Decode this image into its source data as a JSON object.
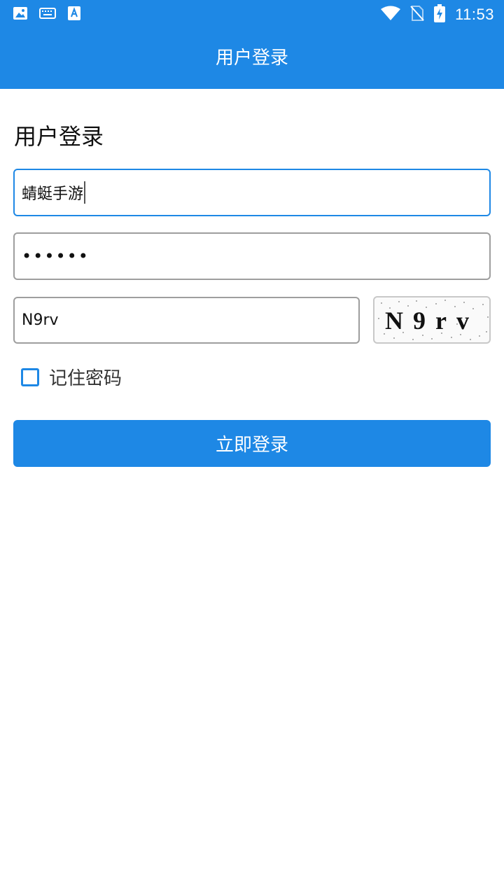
{
  "status_bar": {
    "time": "11:53",
    "left_icons": [
      "image-icon",
      "keyboard-icon",
      "text-a-icon"
    ],
    "right_icons": [
      "wifi-icon",
      "no-sim-icon",
      "battery-charging-icon"
    ]
  },
  "app_bar": {
    "title": "用户登录"
  },
  "form": {
    "heading": "用户登录",
    "username_value": "蜻蜓手游",
    "password_value": "••••••",
    "captcha_value": "N9rv",
    "captcha_image_text": "N9rv",
    "remember_label": "记住密码",
    "remember_checked": false,
    "submit_label": "立即登录"
  },
  "colors": {
    "accent": "#1e88e5",
    "border": "#9e9e9e",
    "background": "#ffffff"
  }
}
